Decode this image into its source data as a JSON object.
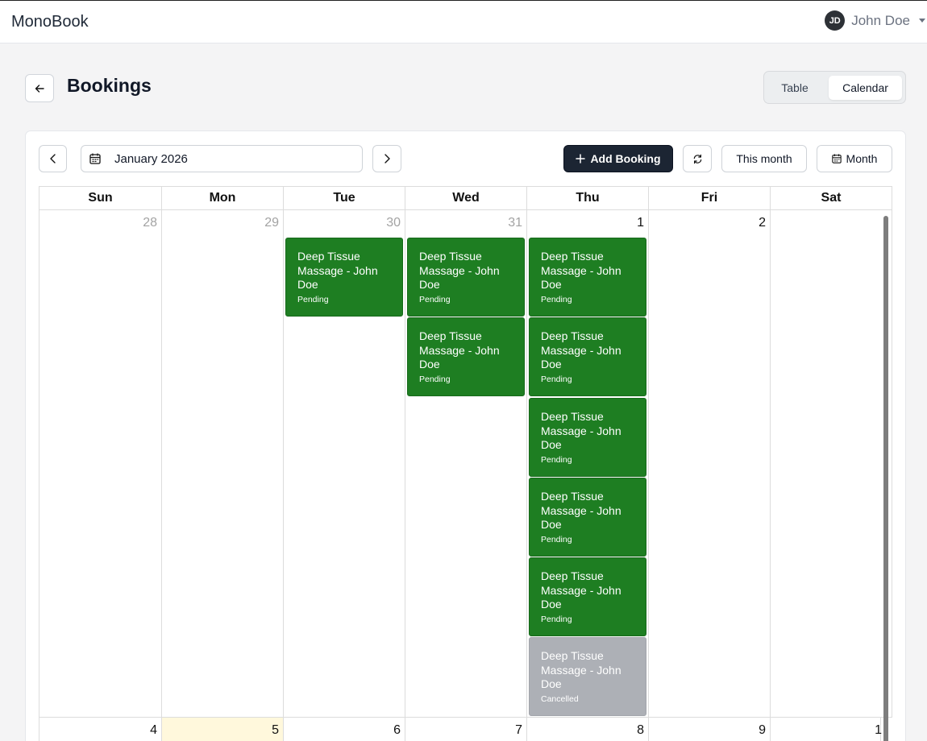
{
  "app": {
    "brand": "MonoBook"
  },
  "user": {
    "initials": "JD",
    "name": "John Doe"
  },
  "page": {
    "title": "Bookings"
  },
  "view_toggle": {
    "table": "Table",
    "calendar": "Calendar",
    "selected": "Calendar"
  },
  "toolbar": {
    "date_label": "January 2026",
    "add_booking": "Add Booking",
    "this_month": "This month",
    "view_mode": "Month"
  },
  "calendar": {
    "weekdays": [
      "Sun",
      "Mon",
      "Tue",
      "Wed",
      "Thu",
      "Fri",
      "Sat"
    ],
    "week1": [
      "28",
      "29",
      "30",
      "31",
      "1",
      "2",
      ""
    ],
    "week2": [
      "4",
      "5",
      "6",
      "7",
      "8",
      "9",
      "1"
    ],
    "events": {
      "tue": [
        {
          "title": "Deep Tissue Massage - John Doe",
          "status": "Pending"
        }
      ],
      "wed": [
        {
          "title": "Deep Tissue Massage - John Doe",
          "status": "Pending"
        },
        {
          "title": "Deep Tissue Massage - John Doe",
          "status": "Pending"
        }
      ],
      "thu": [
        {
          "title": "Deep Tissue Massage - John Doe",
          "status": "Pending"
        },
        {
          "title": "Deep Tissue Massage - John Doe",
          "status": "Pending"
        },
        {
          "title": "Deep Tissue Massage - John Doe",
          "status": "Pending"
        },
        {
          "title": "Deep Tissue Massage - John Doe",
          "status": "Pending"
        },
        {
          "title": "Deep Tissue Massage - John Doe",
          "status": "Pending"
        },
        {
          "title": "Deep Tissue Massage - John Doe",
          "status": "Cancelled"
        }
      ]
    }
  },
  "colors": {
    "pending": "#1e7e22",
    "cancelled": "#adb0b6",
    "today": "#fff8dc",
    "primary": "#1c2533"
  }
}
